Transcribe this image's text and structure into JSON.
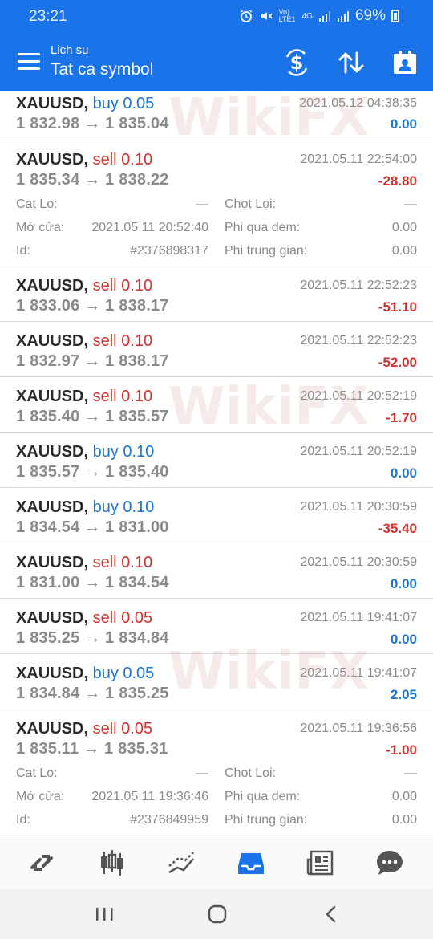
{
  "status_bar": {
    "time": "23:21",
    "network_label": "Vo) LTE1",
    "network_type": "4G",
    "battery": "69%"
  },
  "header": {
    "subtitle": "Lich su",
    "title": "Tat ca symbol"
  },
  "labels": {
    "cat_lo": "Cat Lo:",
    "chot_loi": "Chot Loi:",
    "mo_cua": "Mở cửa:",
    "phi_qua_dem": "Phi qua dem:",
    "id": "Id:",
    "phi_trung_gian": "Phi trung gian:"
  },
  "trades": [
    {
      "symbol": "XAUUSD,",
      "side": "buy 0.05",
      "type": "buy",
      "prices": "1 832.98 → 1 835.04",
      "datetime": "2021.05.12 04:38:35",
      "pl": "0.00",
      "pl_sign": "pos"
    },
    {
      "symbol": "XAUUSD,",
      "side": "sell 0.10",
      "type": "sell",
      "prices": "1 835.34 → 1 838.22",
      "datetime": "2021.05.11 22:54:00",
      "pl": "-28.80",
      "pl_sign": "neg",
      "details": {
        "cat_lo": "—",
        "chot_loi": "—",
        "mo_cua": "2021.05.11 20:52:40",
        "phi_qua_dem": "0.00",
        "id": "#2376898317",
        "phi_trung_gian": "0.00"
      }
    },
    {
      "symbol": "XAUUSD,",
      "side": "sell 0.10",
      "type": "sell",
      "prices": "1 833.06 → 1 838.17",
      "datetime": "2021.05.11 22:52:23",
      "pl": "-51.10",
      "pl_sign": "neg"
    },
    {
      "symbol": "XAUUSD,",
      "side": "sell 0.10",
      "type": "sell",
      "prices": "1 832.97 → 1 838.17",
      "datetime": "2021.05.11 22:52:23",
      "pl": "-52.00",
      "pl_sign": "neg"
    },
    {
      "symbol": "XAUUSD,",
      "side": "sell 0.10",
      "type": "sell",
      "prices": "1 835.40 → 1 835.57",
      "datetime": "2021.05.11 20:52:19",
      "pl": "-1.70",
      "pl_sign": "neg"
    },
    {
      "symbol": "XAUUSD,",
      "side": "buy 0.10",
      "type": "buy",
      "prices": "1 835.57 → 1 835.40",
      "datetime": "2021.05.11 20:52:19",
      "pl": "0.00",
      "pl_sign": "pos"
    },
    {
      "symbol": "XAUUSD,",
      "side": "buy 0.10",
      "type": "buy",
      "prices": "1 834.54 → 1 831.00",
      "datetime": "2021.05.11 20:30:59",
      "pl": "-35.40",
      "pl_sign": "neg"
    },
    {
      "symbol": "XAUUSD,",
      "side": "sell 0.10",
      "type": "sell",
      "prices": "1 831.00 → 1 834.54",
      "datetime": "2021.05.11 20:30:59",
      "pl": "0.00",
      "pl_sign": "pos"
    },
    {
      "symbol": "XAUUSD,",
      "side": "sell 0.05",
      "type": "sell",
      "prices": "1 835.25 → 1 834.84",
      "datetime": "2021.05.11 19:41:07",
      "pl": "0.00",
      "pl_sign": "pos"
    },
    {
      "symbol": "XAUUSD,",
      "side": "buy 0.05",
      "type": "buy",
      "prices": "1 834.84 → 1 835.25",
      "datetime": "2021.05.11 19:41:07",
      "pl": "2.05",
      "pl_sign": "pos"
    },
    {
      "symbol": "XAUUSD,",
      "side": "sell 0.05",
      "type": "sell",
      "prices": "1 835.11 → 1 835.31",
      "datetime": "2021.05.11 19:36:56",
      "pl": "-1.00",
      "pl_sign": "neg",
      "details": {
        "cat_lo": "—",
        "chot_loi": "—",
        "mo_cua": "2021.05.11 19:36:46",
        "phi_qua_dem": "0.00",
        "id": "#2376849959",
        "phi_trung_gian": "0.00"
      }
    }
  ],
  "watermark": "WikiFX",
  "bottom_nav": [
    "quotes-icon",
    "chart-icon",
    "trade-icon",
    "history-icon",
    "news-icon",
    "chat-icon"
  ],
  "colors": {
    "accent": "#1a73e8",
    "buy": "#1976d2",
    "sell": "#d32f2f"
  }
}
